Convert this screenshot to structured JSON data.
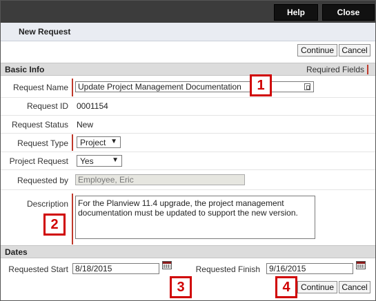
{
  "header": {
    "help_label": "Help",
    "close_label": "Close"
  },
  "page": {
    "title": "New Request"
  },
  "actions": {
    "continue_label": "Continue",
    "cancel_label": "Cancel"
  },
  "basic_info": {
    "section_title": "Basic Info",
    "required_fields_label": "Required Fields",
    "request_name": {
      "label": "Request Name",
      "value": "Update Project Management Documentation"
    },
    "request_id": {
      "label": "Request ID",
      "value": "0001154"
    },
    "request_status": {
      "label": "Request Status",
      "value": "New"
    },
    "request_type": {
      "label": "Request Type",
      "value": "Project"
    },
    "project_request": {
      "label": "Project Request",
      "value": "Yes"
    },
    "requested_by": {
      "label": "Requested by",
      "value": "Employee, Eric"
    },
    "description": {
      "label": "Description",
      "value": "For the Planview 11.4 upgrade, the project management documentation must be updated to support the new version."
    }
  },
  "dates": {
    "section_title": "Dates",
    "requested_start": {
      "label": "Requested Start",
      "value": "8/18/2015"
    },
    "requested_finish": {
      "label": "Requested Finish",
      "value": "9/16/2015"
    }
  },
  "callouts": [
    "1",
    "2",
    "3",
    "4"
  ],
  "colors": {
    "topbar": "#3c3c3c",
    "accent_red": "#c0392b",
    "callout_red": "#d00000",
    "section_bg": "#dcdcdc"
  }
}
